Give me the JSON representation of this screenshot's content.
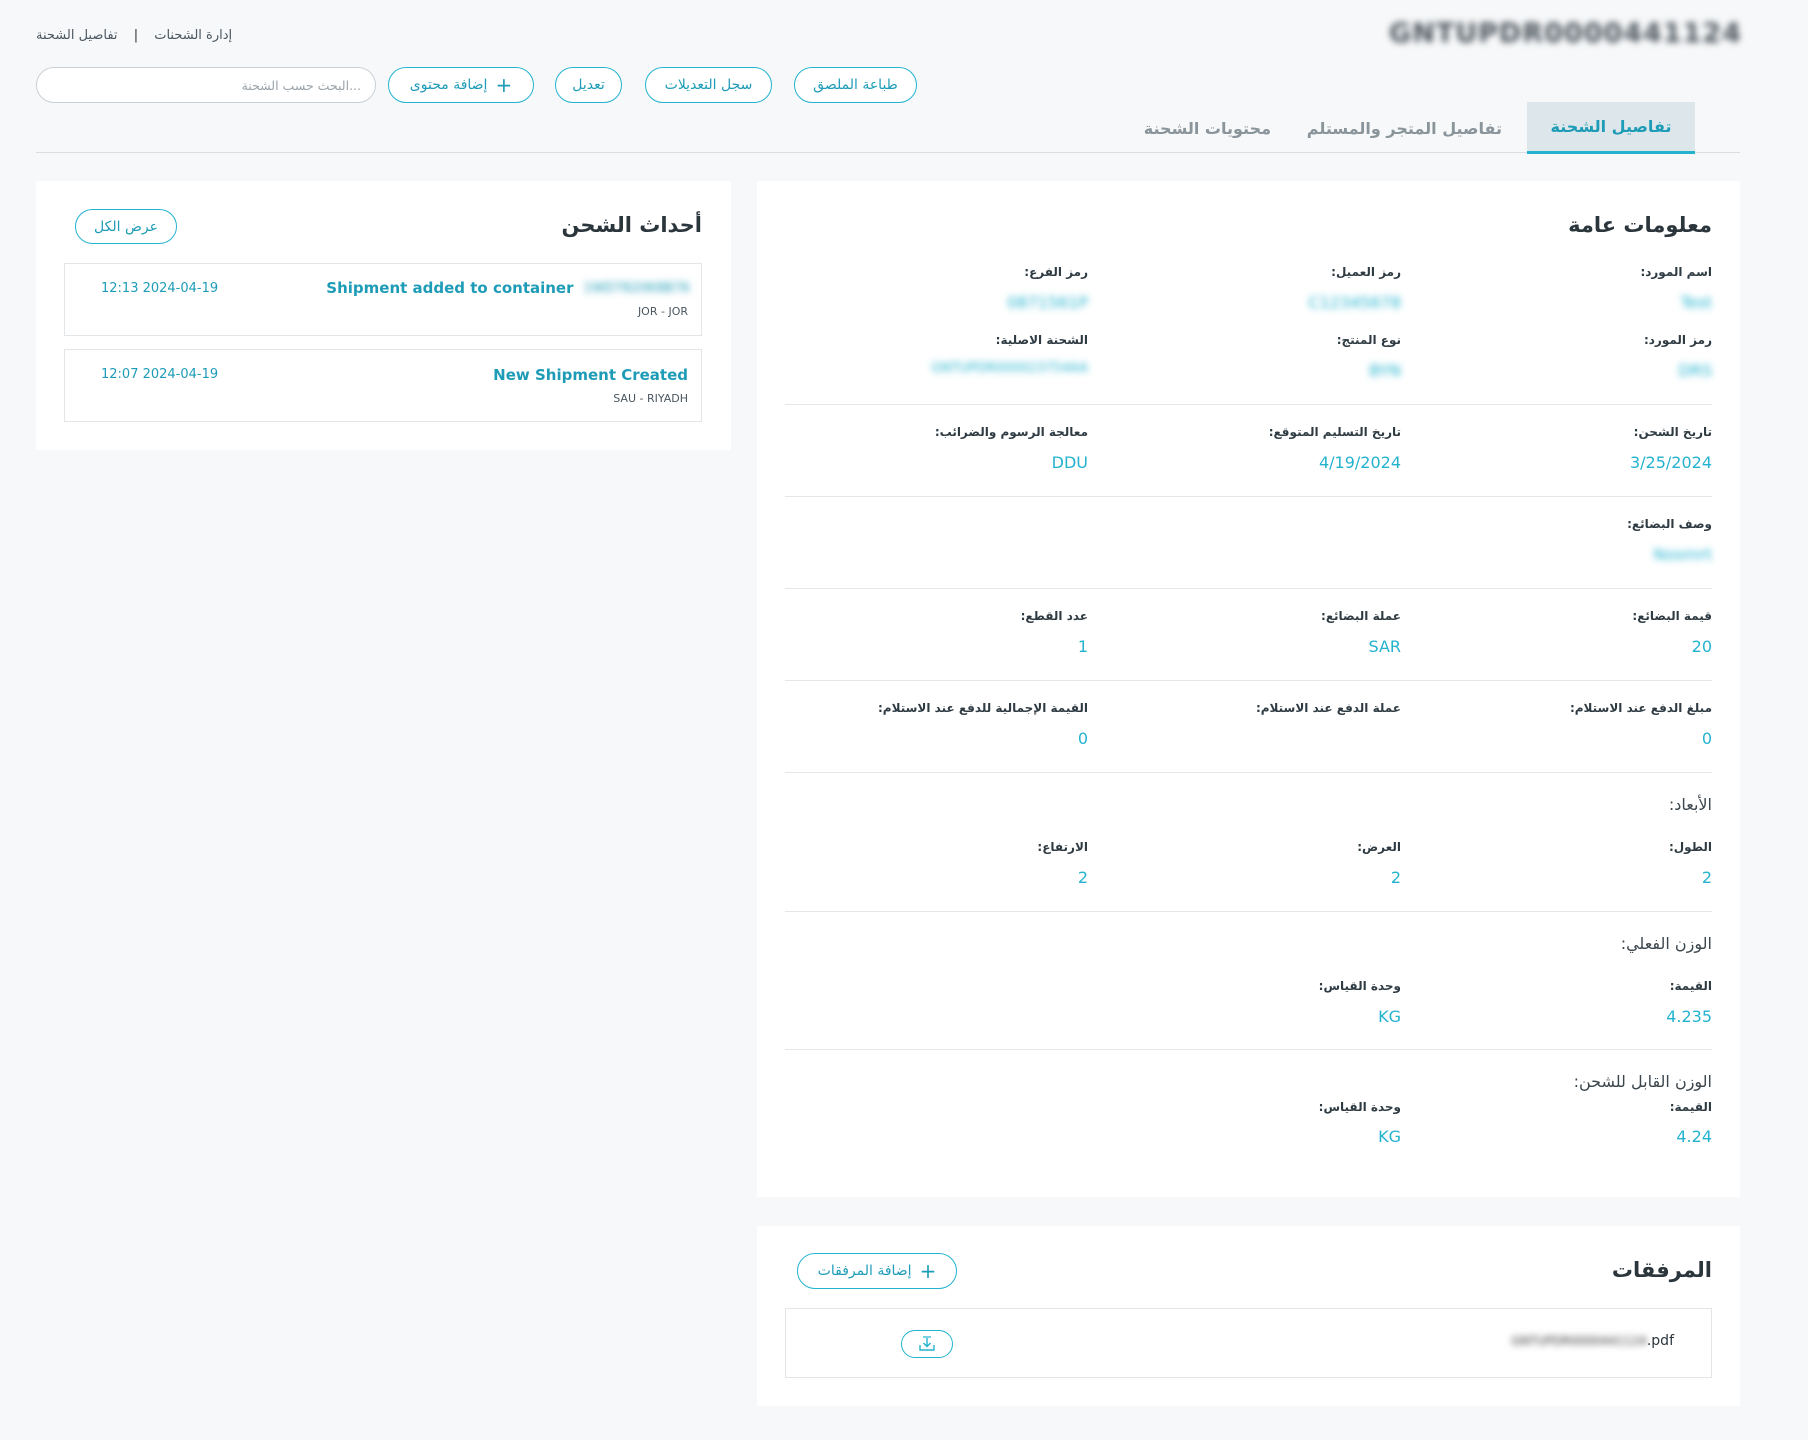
{
  "header": {
    "breadcrumb_root": "إدارة الشحنات",
    "breadcrumb_separator": "|",
    "breadcrumb_current": "تفاصيل الشحنة",
    "shipment_id": "GNTUPDR0000441124"
  },
  "toolbar": {
    "search_placeholder": "...البحث حسب الشحنة",
    "add_content_label": "إضافة محتوى",
    "edit_label": "تعديل",
    "history_label": "سجل التعديلات",
    "print_label": "طباعة الملصق"
  },
  "tabs": [
    {
      "label": "تفاصيل الشحنة",
      "active": true
    },
    {
      "label": "تفاصيل المتجر والمستلم",
      "active": false
    },
    {
      "label": "محتويات الشحنة",
      "active": false
    }
  ],
  "general": {
    "title": "معلومات عامة",
    "supplier_name_label": "اسم المورد:",
    "supplier_name_value": "Test",
    "client_code_label": "رمز العميل:",
    "client_code_value": "C12345678",
    "branch_code_label": "رمز الفرع:",
    "branch_code_value": "0871561P",
    "supplier_code_label": "رمز المورد:",
    "supplier_code_value": "DRS",
    "product_type_label": "نوع المنتج:",
    "product_type_value": "BYN",
    "original_shipment_label": "الشحنة الاصلية:",
    "original_shipment_value": "GNTUPDR000023754AA",
    "ship_date_label": "تاريخ الشحن:",
    "ship_date_value": "3/25/2024",
    "expected_delivery_label": "تاريخ التسليم المتوقع:",
    "expected_delivery_value": "4/19/2024",
    "fees_label": "معالجة الرسوم والضرائب:",
    "fees_value": "DDU",
    "goods_desc_label": "وصف البضائع:",
    "goods_desc_value": "Nosmrt",
    "goods_value_label": "قيمة البضائع:",
    "goods_value_value": "20",
    "goods_currency_label": "عملة البضائع:",
    "goods_currency_value": "SAR",
    "pieces_label": "عدد القطع:",
    "pieces_value": "1",
    "cod_amount_label": "مبلغ الدفع عند الاستلام:",
    "cod_amount_value": "0",
    "cod_currency_label": "عملة الدفع عند الاستلام:",
    "cod_currency_value": "",
    "cod_total_label": "القيمة الإجمالية للدفع عند الاستلام:",
    "cod_total_value": "0",
    "dimensions_heading": "الأبعاد:",
    "length_label": "الطول:",
    "length_value": "2",
    "width_label": "العرض:",
    "width_value": "2",
    "height_label": "الارتفاع:",
    "height_value": "2",
    "actual_weight_heading": "الوزن الفعلي:",
    "actual_value_label": "القيمة:",
    "actual_value_value": "4.235",
    "actual_unit_label": "وحدة القياس:",
    "actual_unit_value": "KG",
    "chargeable_weight_heading": "الوزن القابل للشحن:",
    "chargeable_value_label": "القيمة:",
    "chargeable_value_value": "4.24",
    "chargeable_unit_label": "وحدة القياس:",
    "chargeable_unit_value": "KG"
  },
  "events": {
    "title": "أحداث الشحن",
    "view_all_label": "عرض الكل",
    "items": [
      {
        "title": "Shipment added to container",
        "ref": "1WD7820K8B76",
        "sub": "JOR - JOR",
        "date": "12:13 2024-04-19"
      },
      {
        "title": "New Shipment Created",
        "ref": "",
        "sub": "SAU - RIYADH",
        "date": "12:07 2024-04-19"
      }
    ]
  },
  "attachments": {
    "title": "المرفقات",
    "add_label": "إضافة المرفقات",
    "file_name_blur": "GNTUPDR0000441124",
    "file_ext": ".pdf"
  },
  "colors": {
    "accent": "#23b3cf",
    "background": "#f7f8f9",
    "card": "#ffffff",
    "active_tab_bg": "#dde6ea"
  }
}
